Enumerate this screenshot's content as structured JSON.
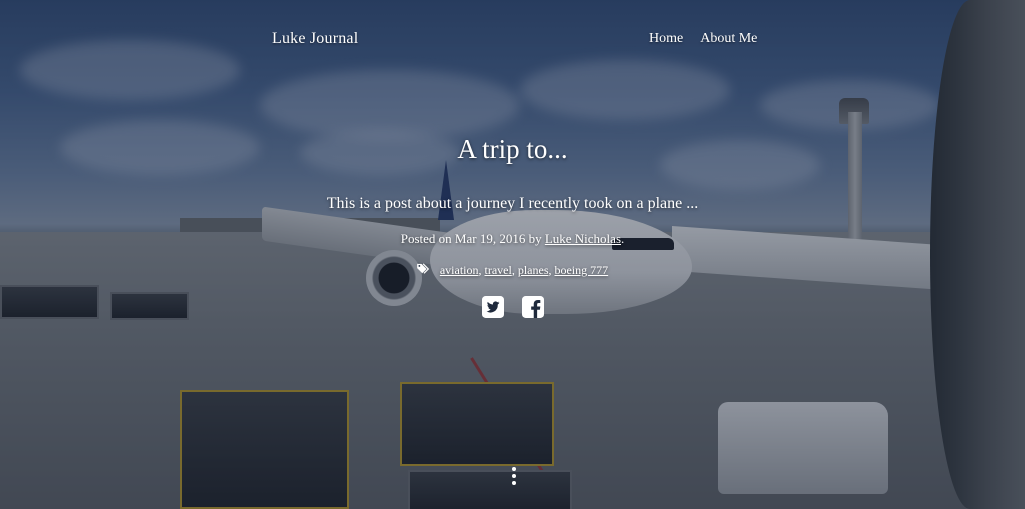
{
  "header": {
    "site_title": "Luke Journal",
    "nav": [
      {
        "label": "Home"
      },
      {
        "label": "About Me"
      }
    ]
  },
  "post": {
    "title": "A trip to...",
    "subtitle": "This is a post about a journey I recently took on a plane ...",
    "meta": {
      "posted_on_prefix": "Posted on",
      "date": "Mar 19, 2016",
      "by": "by",
      "author": "Luke Nicholas",
      "period": "."
    },
    "tags": [
      {
        "label": "aviation",
        "sep": ","
      },
      {
        "label": "travel",
        "sep": ","
      },
      {
        "label": "planes",
        "sep": ","
      },
      {
        "label": "boeing 777",
        "sep": ""
      }
    ]
  },
  "social": [
    {
      "icon": "twitter-icon"
    },
    {
      "icon": "facebook-icon"
    }
  ],
  "colors": {
    "text": "#ffffff",
    "overlay": "#121e32"
  }
}
